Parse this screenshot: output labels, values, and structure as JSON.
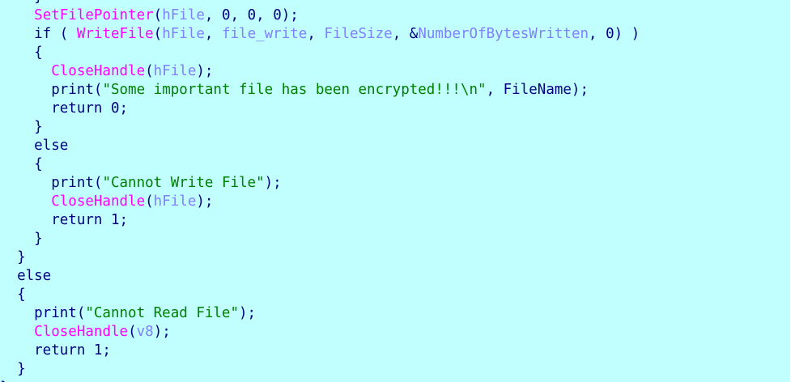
{
  "colors": {
    "background": "#c1ffff",
    "plain": "#000080",
    "imported_function": "#ff00ff",
    "local_variable": "#8080ff",
    "string_literal": "#008000"
  },
  "code_lines": [
    [
      {
        "k": "plain",
        "t": "    }"
      }
    ],
    [
      {
        "k": "plain",
        "t": "    "
      },
      {
        "k": "func",
        "t": "SetFilePointer"
      },
      {
        "k": "plain",
        "t": "("
      },
      {
        "k": "var",
        "t": "hFile"
      },
      {
        "k": "plain",
        "t": ", 0, 0, 0);"
      }
    ],
    [
      {
        "k": "plain",
        "t": "    if ( "
      },
      {
        "k": "func",
        "t": "WriteFile"
      },
      {
        "k": "plain",
        "t": "("
      },
      {
        "k": "var",
        "t": "hFile"
      },
      {
        "k": "plain",
        "t": ", "
      },
      {
        "k": "var",
        "t": "file_write"
      },
      {
        "k": "plain",
        "t": ", "
      },
      {
        "k": "var",
        "t": "FileSize"
      },
      {
        "k": "plain",
        "t": ", &"
      },
      {
        "k": "var",
        "t": "NumberOfBytesWritten"
      },
      {
        "k": "plain",
        "t": ", 0) )"
      }
    ],
    [
      {
        "k": "plain",
        "t": "    {"
      }
    ],
    [
      {
        "k": "plain",
        "t": "      "
      },
      {
        "k": "func",
        "t": "CloseHandle"
      },
      {
        "k": "plain",
        "t": "("
      },
      {
        "k": "var",
        "t": "hFile"
      },
      {
        "k": "plain",
        "t": ");"
      }
    ],
    [
      {
        "k": "plain",
        "t": "      print("
      },
      {
        "k": "str",
        "t": "\"Some important file has been encrypted!!!\\n\""
      },
      {
        "k": "plain",
        "t": ", FileName);"
      }
    ],
    [
      {
        "k": "plain",
        "t": "      return 0;"
      }
    ],
    [
      {
        "k": "plain",
        "t": "    }"
      }
    ],
    [
      {
        "k": "plain",
        "t": "    else"
      }
    ],
    [
      {
        "k": "plain",
        "t": "    {"
      }
    ],
    [
      {
        "k": "plain",
        "t": "      print("
      },
      {
        "k": "str",
        "t": "\"Cannot Write File\""
      },
      {
        "k": "plain",
        "t": ");"
      }
    ],
    [
      {
        "k": "plain",
        "t": "      "
      },
      {
        "k": "func",
        "t": "CloseHandle"
      },
      {
        "k": "plain",
        "t": "("
      },
      {
        "k": "var",
        "t": "hFile"
      },
      {
        "k": "plain",
        "t": ");"
      }
    ],
    [
      {
        "k": "plain",
        "t": "      return 1;"
      }
    ],
    [
      {
        "k": "plain",
        "t": "    }"
      }
    ],
    [
      {
        "k": "plain",
        "t": "  }"
      }
    ],
    [
      {
        "k": "plain",
        "t": "  else"
      }
    ],
    [
      {
        "k": "plain",
        "t": "  {"
      }
    ],
    [
      {
        "k": "plain",
        "t": "    print("
      },
      {
        "k": "str",
        "t": "\"Cannot Read File\""
      },
      {
        "k": "plain",
        "t": ");"
      }
    ],
    [
      {
        "k": "plain",
        "t": "    "
      },
      {
        "k": "func",
        "t": "CloseHandle"
      },
      {
        "k": "plain",
        "t": "("
      },
      {
        "k": "var",
        "t": "v8"
      },
      {
        "k": "plain",
        "t": ");"
      }
    ],
    [
      {
        "k": "plain",
        "t": "    return 1;"
      }
    ],
    [
      {
        "k": "plain",
        "t": "  }"
      }
    ],
    [
      {
        "k": "plain",
        "t": "}"
      }
    ]
  ]
}
